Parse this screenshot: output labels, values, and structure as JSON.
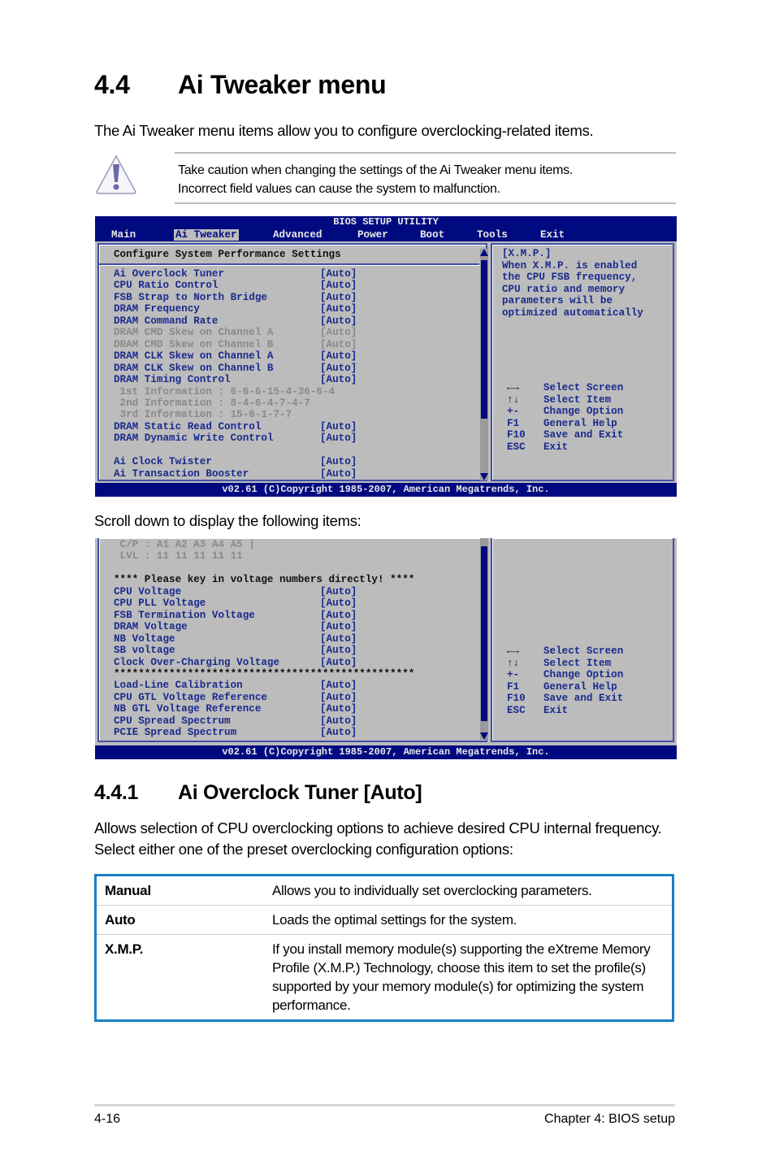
{
  "heading": {
    "number": "4.4",
    "title": "Ai Tweaker menu"
  },
  "intro": "The Ai Tweaker menu items allow you to configure overclocking-related items.",
  "caution": {
    "icon": "warning-triangle-icon",
    "lines": [
      "Take caution when changing the settings of the Ai Tweaker menu items.",
      "Incorrect field values can cause the system to malfunction."
    ]
  },
  "bios_colors": {
    "header_bg": "#000a80",
    "panel_bg": "#bcbcbc",
    "item_text": "#1a2a8c",
    "disabled_text": "#8a8a8a"
  },
  "bios1": {
    "title": "BIOS SETUP UTILITY",
    "menu": [
      "Main",
      "Ai Tweaker",
      "Advanced",
      "Power",
      "Boot",
      "Tools",
      "Exit"
    ],
    "active_menu": "Ai Tweaker",
    "section_title": "Configure System Performance Settings",
    "items": [
      {
        "label": "Ai Overclock Tuner",
        "value": "[Auto]"
      },
      {
        "label": "CPU Ratio Control",
        "value": "[Auto]"
      },
      {
        "label": "FSB Strap to North Bridge",
        "value": "[Auto]"
      },
      {
        "label": "DRAM Frequency",
        "value": "[Auto]"
      },
      {
        "label": "DRAM Command Rate",
        "value": "[Auto]"
      },
      {
        "label": "DRAM CMD Skew on Channel A",
        "value": "[Auto]",
        "disabled": true
      },
      {
        "label": "DRAM CMD Skew on Channel B",
        "value": "[Auto]",
        "disabled": true
      },
      {
        "label": "DRAM CLK Skew on Channel A",
        "value": "[Auto]"
      },
      {
        "label": "DRAM CLK Skew on Channel B",
        "value": "[Auto]"
      },
      {
        "label": "DRAM Timing Control",
        "value": "[Auto]"
      },
      {
        "label": " 1st Information : 6-6-6-15-4-36-6-4",
        "value": "",
        "disabled": true
      },
      {
        "label": " 2nd Information : 8-4-6-4-7-4-7",
        "value": "",
        "disabled": true
      },
      {
        "label": " 3rd Information : 15-6-1-7-7",
        "value": "",
        "disabled": true
      },
      {
        "label": "DRAM Static Read Control",
        "value": "[Auto]"
      },
      {
        "label": "DRAM Dynamic Write Control",
        "value": "[Auto]"
      },
      {
        "label": "",
        "value": ""
      },
      {
        "label": "Ai Clock Twister",
        "value": "[Auto]"
      },
      {
        "label": "Ai Transaction Booster",
        "value": "[Auto]"
      }
    ],
    "help_lines": [
      "[X.M.P.]",
      "When X.M.P. is enabled",
      "the CPU FSB frequency,",
      "CPU ratio and memory",
      "parameters will be",
      "optimized automatically"
    ],
    "footer": "v02.61 (C)Copyright 1985-2007, American Megatrends, Inc."
  },
  "keys": [
    {
      "key": "←→",
      "action": "Select Screen"
    },
    {
      "key": "↑↓",
      "action": "Select Item"
    },
    {
      "key": "+-",
      "action": "Change Option"
    },
    {
      "key": "F1",
      "action": "General Help"
    },
    {
      "key": "F10",
      "action": "Save and Exit"
    },
    {
      "key": "ESC",
      "action": "Exit"
    }
  ],
  "scroll_note": "Scroll down to display the following items:",
  "bios2": {
    "items": [
      {
        "label": " C/P : A1 A2 A3 A4 A5 |",
        "value": "",
        "style": "gray"
      },
      {
        "label": " LVL : 11 11 11 11 11",
        "value": "",
        "style": "gray"
      },
      {
        "label": "",
        "value": ""
      },
      {
        "label": "**** Please key in voltage numbers directly! ****",
        "value": "",
        "style": "black"
      },
      {
        "label": "CPU Voltage",
        "value": "[Auto]"
      },
      {
        "label": "CPU PLL Voltage",
        "value": "[Auto]"
      },
      {
        "label": "FSB Termination Voltage",
        "value": "[Auto]"
      },
      {
        "label": "DRAM Voltage",
        "value": "[Auto]"
      },
      {
        "label": "NB Voltage",
        "value": "[Auto]"
      },
      {
        "label": "SB voltage",
        "value": "[Auto]"
      },
      {
        "label": "Clock Over-Charging Voltage",
        "value": "[Auto]"
      },
      {
        "label": "*************************************************",
        "value": "",
        "style": "black"
      },
      {
        "label": "Load-Line Calibration",
        "value": "[Auto]"
      },
      {
        "label": "CPU GTL Voltage Reference",
        "value": "[Auto]"
      },
      {
        "label": "NB GTL Voltage Reference",
        "value": "[Auto]"
      },
      {
        "label": "CPU Spread Spectrum",
        "value": "[Auto]"
      },
      {
        "label": "PCIE Spread Spectrum",
        "value": "[Auto]"
      }
    ],
    "footer": "v02.61 (C)Copyright 1985-2007, American Megatrends, Inc."
  },
  "subheading": {
    "number": "4.4.1",
    "title": "Ai Overclock Tuner [Auto]"
  },
  "subparagraph": "Allows selection of CPU overclocking options to achieve desired CPU internal frequency. Select either one of the preset overclocking configuration options:",
  "options_table": {
    "border_color": "#1a7fc4",
    "rows": [
      {
        "name": "Manual",
        "desc": "Allows you to individually set overclocking parameters."
      },
      {
        "name": "Auto",
        "desc": "Loads the optimal settings for the system."
      },
      {
        "name": "X.M.P.",
        "desc": "If you install memory module(s) supporting the eXtreme Memory Profile (X.M.P.) Technology, choose this item to set the profile(s) supported by your memory module(s) for optimizing the system performance."
      }
    ]
  },
  "footer": {
    "page": "4-16",
    "chapter": "Chapter 4: BIOS setup"
  }
}
